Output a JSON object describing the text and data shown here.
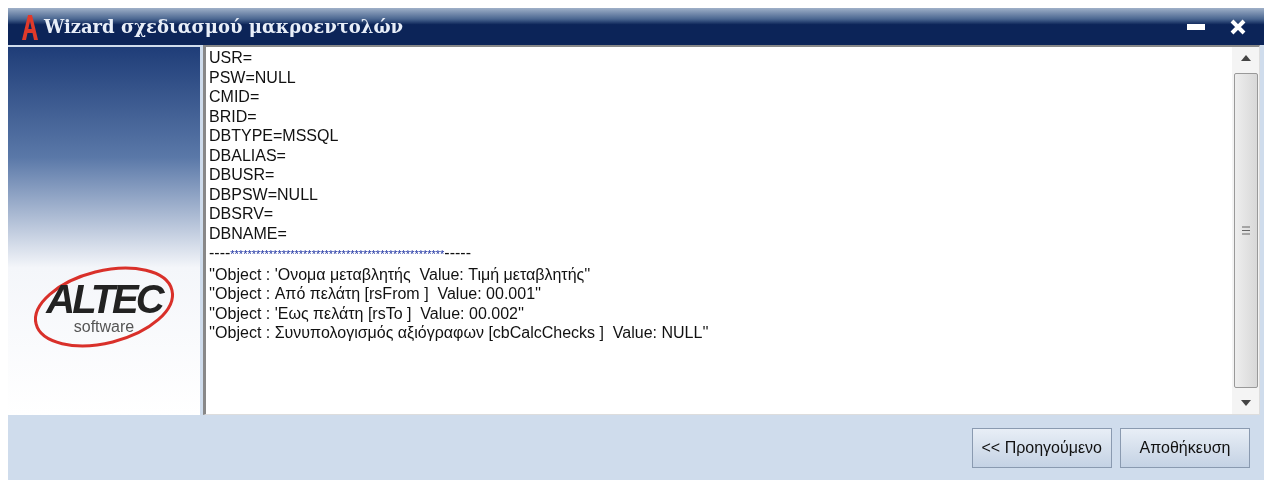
{
  "window": {
    "title": "Wizard σχεδιασμού μακροεντολών"
  },
  "logo": {
    "name": "ALTEC",
    "tagline": "software"
  },
  "editor": {
    "lines": [
      {
        "kind": "text",
        "text": "USR="
      },
      {
        "kind": "text",
        "text": "PSW=NULL"
      },
      {
        "kind": "text",
        "text": "CMID="
      },
      {
        "kind": "text",
        "text": "BRID="
      },
      {
        "kind": "text",
        "text": "DBTYPE=MSSQL"
      },
      {
        "kind": "text",
        "text": "DBALIAS="
      },
      {
        "kind": "text",
        "text": "DBUSR="
      },
      {
        "kind": "text",
        "text": "DBPSW=NULL"
      },
      {
        "kind": "text",
        "text": "DBSRV="
      },
      {
        "kind": "text",
        "text": "DBNAME="
      },
      {
        "kind": "separator",
        "lead": "----",
        "stars": "**************************************************",
        "tail": "-----"
      },
      {
        "kind": "text",
        "text": "''Object : 'Ονομα μεταβλητής  Value: Τιμή μεταβλητής''"
      },
      {
        "kind": "text",
        "text": "''Object : Από πελάτη [rsFrom ]  Value: 00.001''"
      },
      {
        "kind": "text",
        "text": "''Object : 'Εως πελάτη [rsTo ]  Value: 00.002''"
      },
      {
        "kind": "text",
        "text": "''Object : Συνυπολογισμός αξιόγραφων [cbCalcChecks ]  Value: NULL''"
      }
    ]
  },
  "buttons": [
    {
      "label": "<< Προηγούμενο"
    },
    {
      "label": "Αποθήκευση"
    }
  ]
}
